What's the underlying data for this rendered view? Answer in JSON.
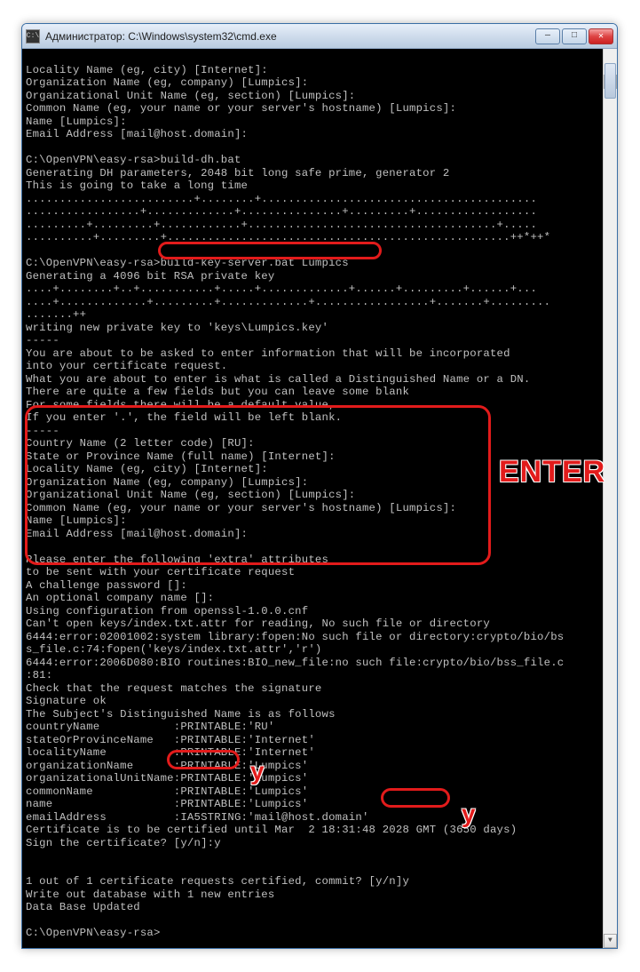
{
  "titlebar": {
    "icon_glyph": "C:\\",
    "text": "Администратор: C:\\Windows\\system32\\cmd.exe"
  },
  "window_controls": {
    "minimize": "—",
    "maximize": "□",
    "close": "✕"
  },
  "scrollbar": {
    "up": "▲",
    "down": "▼"
  },
  "annotations": {
    "enter": "ENTER",
    "y1": "y",
    "y2": "y"
  },
  "lines": {
    "l0": "Locality Name (eg, city) [Internet]:",
    "l1": "Organization Name (eg, company) [Lumpics]:",
    "l2": "Organizational Unit Name (eg, section) [Lumpics]:",
    "l3": "Common Name (eg, your name or your server's hostname) [Lumpics]:",
    "l4": "Name [Lumpics]:",
    "l5": "Email Address [mail@host.domain]:",
    "blank0": "",
    "l6": "C:\\OpenVPN\\easy-rsa>build-dh.bat",
    "l7": "Generating DH parameters, 2048 bit long safe prime, generator 2",
    "l8": "This is going to take a long time",
    "l9": ".........................+........+.........................................",
    "l10": ".................+.............+...............+.........+..................",
    "l11": ".........+.........+............+.....................................+.....",
    "l12": "..........+.........+...................................................++*++*",
    "blank1": "",
    "l13a": "C:\\OpenVPN\\easy-rsa>",
    "l13b": "build-key-server.bat Lumpics",
    "l14": "Generating a 4096 bit RSA private key",
    "l15": "....+........+..+...........+.....+.............+......+.........+......+...",
    "l16": "....+.............+.........+.............+.................+.......+.........",
    "l17": ".......++",
    "l18": "writing new private key to 'keys\\Lumpics.key'",
    "l19": "-----",
    "l20": "You are about to be asked to enter information that will be incorporated",
    "l21": "into your certificate request.",
    "l22": "What you are about to enter is what is called a Distinguished Name or a DN.",
    "l23": "There are quite a few fields but you can leave some blank",
    "l24": "For some fields there will be a default value,",
    "l25": "If you enter '.', the field will be left blank.",
    "l26": "-----",
    "l27": "Country Name (2 letter code) [RU]:",
    "l28": "State or Province Name (full name) [Internet]:",
    "l29": "Locality Name (eg, city) [Internet]:",
    "l30": "Organization Name (eg, company) [Lumpics]:",
    "l31": "Organizational Unit Name (eg, section) [Lumpics]:",
    "l32": "Common Name (eg, your name or your server's hostname) [Lumpics]:",
    "l33": "Name [Lumpics]:",
    "l34": "Email Address [mail@host.domain]:",
    "blank2": "",
    "l35": "Please enter the following 'extra' attributes",
    "l36": "to be sent with your certificate request",
    "l37": "A challenge password []:",
    "l38": "An optional company name []:",
    "l39": "Using configuration from openssl-1.0.0.cnf",
    "l40": "Can't open keys/index.txt.attr for reading, No such file or directory",
    "l41": "6444:error:02001002:system library:fopen:No such file or directory:crypto/bio/bs",
    "l42": "s_file.c:74:fopen('keys/index.txt.attr','r')",
    "l43": "6444:error:2006D080:BIO routines:BIO_new_file:no such file:crypto/bio/bss_file.c",
    "l44": ":81:",
    "l45": "Check that the request matches the signature",
    "l46": "Signature ok",
    "l47": "The Subject's Distinguished Name is as follows",
    "l48": "countryName           :PRINTABLE:'RU'",
    "l49": "stateOrProvinceName   :PRINTABLE:'Internet'",
    "l50": "localityName          :PRINTABLE:'Internet'",
    "l51": "organizationName      :PRINTABLE:'Lumpics'",
    "l52": "organizationalUnitName:PRINTABLE:'Lumpics'",
    "l53": "commonName            :PRINTABLE:'Lumpics'",
    "l54": "name                  :PRINTABLE:'Lumpics'",
    "l55": "emailAddress          :IA5STRING:'mail@host.domain'",
    "l56": "Certificate is to be certified until Mar  2 18:31:48 2028 GMT (3650 days)",
    "l57a": "Sign the certificate? ",
    "l57b": "[y/n]:y",
    "blank3": "",
    "blank4": "",
    "l58a": "1 out of 1 certificate requests certified, commit? ",
    "l58b": "[y/n]y",
    "l59": "Write out database with 1 new entries",
    "l60": "Data Base Updated",
    "blank5": "",
    "l61": "C:\\OpenVPN\\easy-rsa>"
  }
}
